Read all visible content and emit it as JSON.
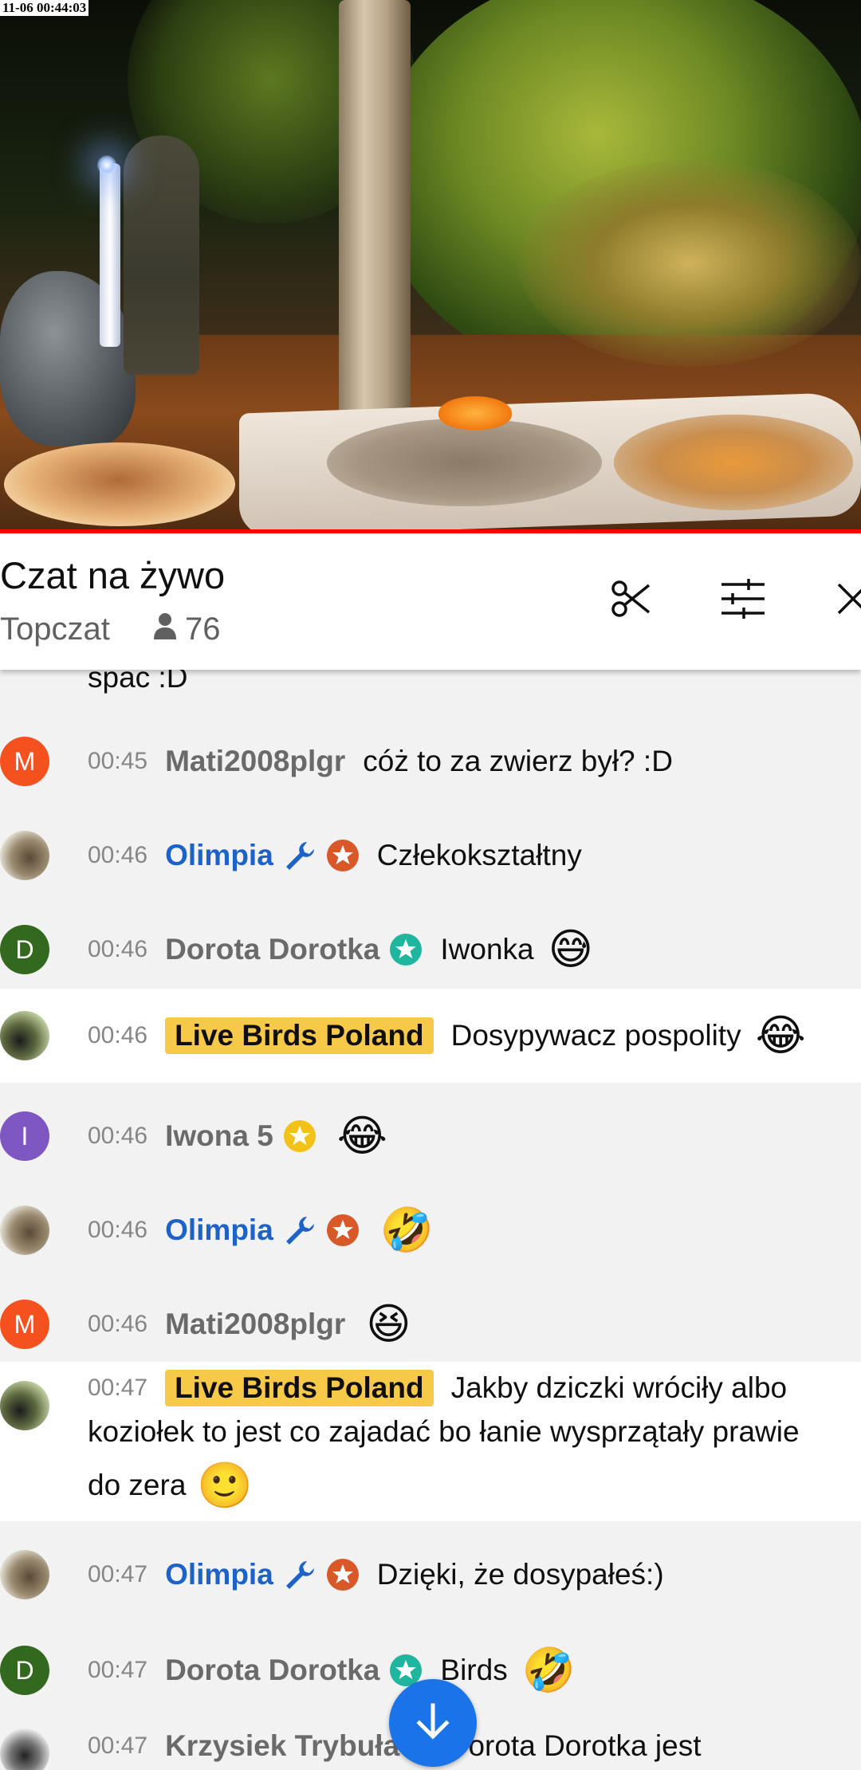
{
  "video": {
    "timestamp": "11-06 00:44:03",
    "progress_color": "#ff0000"
  },
  "chat_header": {
    "title": "Czat na żywo",
    "mode": "Topczat",
    "viewer_count": "76",
    "icons": [
      "person-icon",
      "scissors-icon",
      "filter-icon",
      "close-icon"
    ]
  },
  "messages": [
    {
      "partial_text": "spać :D"
    },
    {
      "avatar_letter": "M",
      "time": "00:45",
      "author": "Mati2008plgr",
      "text": "cóż to za zwierz był? :D"
    },
    {
      "time": "00:46",
      "author": "Olimpia",
      "text": "Człekokształtny",
      "badges": [
        "wrench-icon",
        "star-badge-icon"
      ]
    },
    {
      "avatar_letter": "D",
      "time": "00:46",
      "author": "Dorota Dorotka",
      "text": "Iwonka",
      "emoji": "😅",
      "badges": [
        "star-badge-icon"
      ]
    },
    {
      "time": "00:46",
      "author": "Live Birds Poland",
      "text": "Dosypywacz pospolity",
      "emoji": "😂"
    },
    {
      "avatar_letter": "I",
      "time": "00:46",
      "author": "Iwona 5",
      "emoji": "😂",
      "badges": [
        "star-badge-icon"
      ]
    },
    {
      "time": "00:46",
      "author": "Olimpia",
      "emoji": "🤣",
      "badges": [
        "wrench-icon",
        "star-badge-icon"
      ]
    },
    {
      "avatar_letter": "M",
      "time": "00:46",
      "author": "Mati2008plgr",
      "emoji": "😆"
    },
    {
      "time": "00:47",
      "author": "Live Birds Poland",
      "text_line1": "Jakby dziczki wróciły albo",
      "text_line2": "koziołek to jest co zajadać bo łanie wysprzątały prawie",
      "text_line3": "do zera",
      "emoji": "🙂"
    },
    {
      "time": "00:47",
      "author": "Olimpia",
      "text": "Dzięki, że dosypałeś:)",
      "badges": [
        "wrench-icon",
        "star-badge-icon"
      ]
    },
    {
      "avatar_letter": "D",
      "time": "00:47",
      "author": "Dorota Dorotka",
      "text": "Birds",
      "emoji": "🤣",
      "badges": [
        "star-badge-icon"
      ]
    },
    {
      "time": "00:47",
      "author": "Krzysiek Trybuła",
      "text": "@Dorota Dorotka jest"
    }
  ],
  "colors": {
    "moderator": "#1d62c8",
    "owner_badge": "#f7c948",
    "fab": "#1a73e8",
    "avatar_m": "#f4511e",
    "avatar_d": "#33691e",
    "avatar_i": "#7e57c2"
  }
}
